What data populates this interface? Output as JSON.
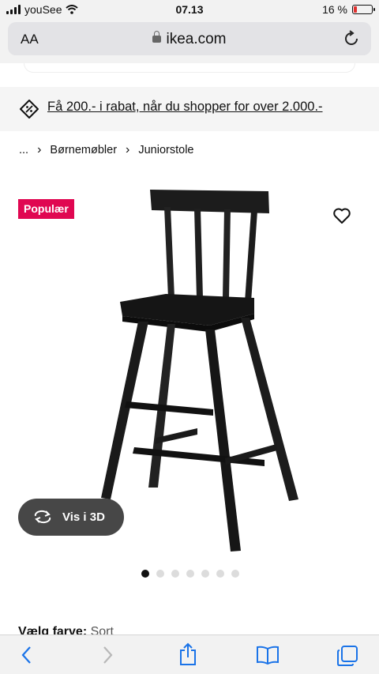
{
  "status_bar": {
    "carrier": "youSee",
    "time": "07.13",
    "battery": "16 %",
    "battery_level": 0.16
  },
  "browser": {
    "text_size_label": "AA",
    "url": "ikea.com"
  },
  "promo": {
    "text": "Få 200.- i rabat, når du shopper for over 2.000.-"
  },
  "breadcrumb": {
    "ellipsis": "...",
    "items": [
      "Børnemøbler",
      "Juniorstole"
    ]
  },
  "product": {
    "badge": "Populær",
    "view_3d_label": "Vis i 3D",
    "image_count": 7,
    "active_image": 0,
    "color_label": "Vælg farve:",
    "color_value": "Sort"
  },
  "toolbar": {
    "icons": [
      "back-icon",
      "forward-icon",
      "share-icon",
      "bookmarks-icon",
      "tabs-icon"
    ]
  },
  "colors": {
    "badge_bg": "#e00751",
    "browser_accent": "#1a73e8",
    "button_bg": "#474747",
    "battery_low": "#e0312f"
  }
}
